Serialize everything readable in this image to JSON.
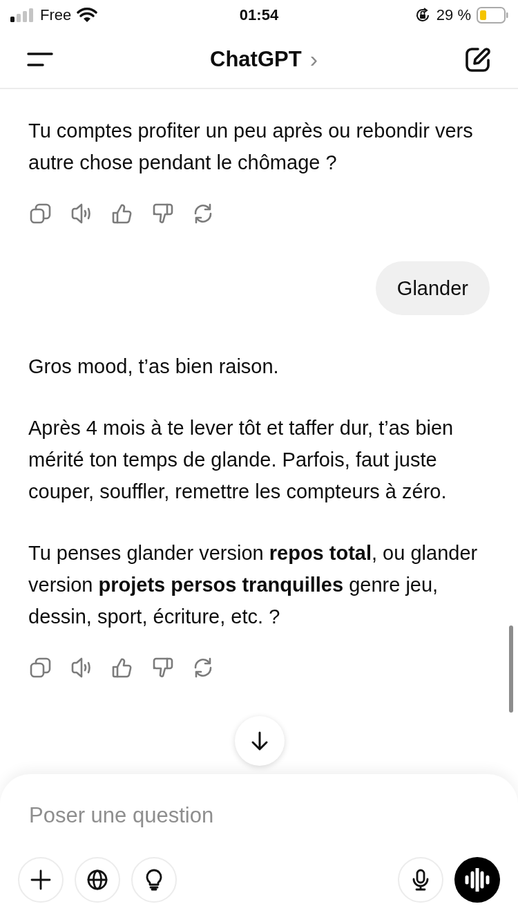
{
  "status_bar": {
    "carrier": "Free",
    "time": "01:54",
    "battery": "29 %"
  },
  "header": {
    "title": "ChatGPT",
    "chevron": "›"
  },
  "messages": [
    {
      "kind": "assistant",
      "paragraphs": [
        "Tu comptes profiter un peu après ou rebondir vers autre chose pendant le chômage ?"
      ]
    },
    {
      "kind": "actions"
    },
    {
      "kind": "user",
      "text": "Glander"
    },
    {
      "kind": "assistant",
      "paragraphs": [
        "Gros mood, t’as bien raison.",
        "Après 4 mois à te lever tôt et taffer dur, t’as bien mérité ton temps de glande. Parfois, faut juste couper, souffler, remettre les compteurs à zéro.",
        "Tu penses glander version **repos total**, ou glander version **projets persos tranquilles** genre jeu, dessin, sport, écriture, etc. ?"
      ]
    },
    {
      "kind": "actions"
    }
  ],
  "composer": {
    "placeholder": "Poser une question"
  }
}
